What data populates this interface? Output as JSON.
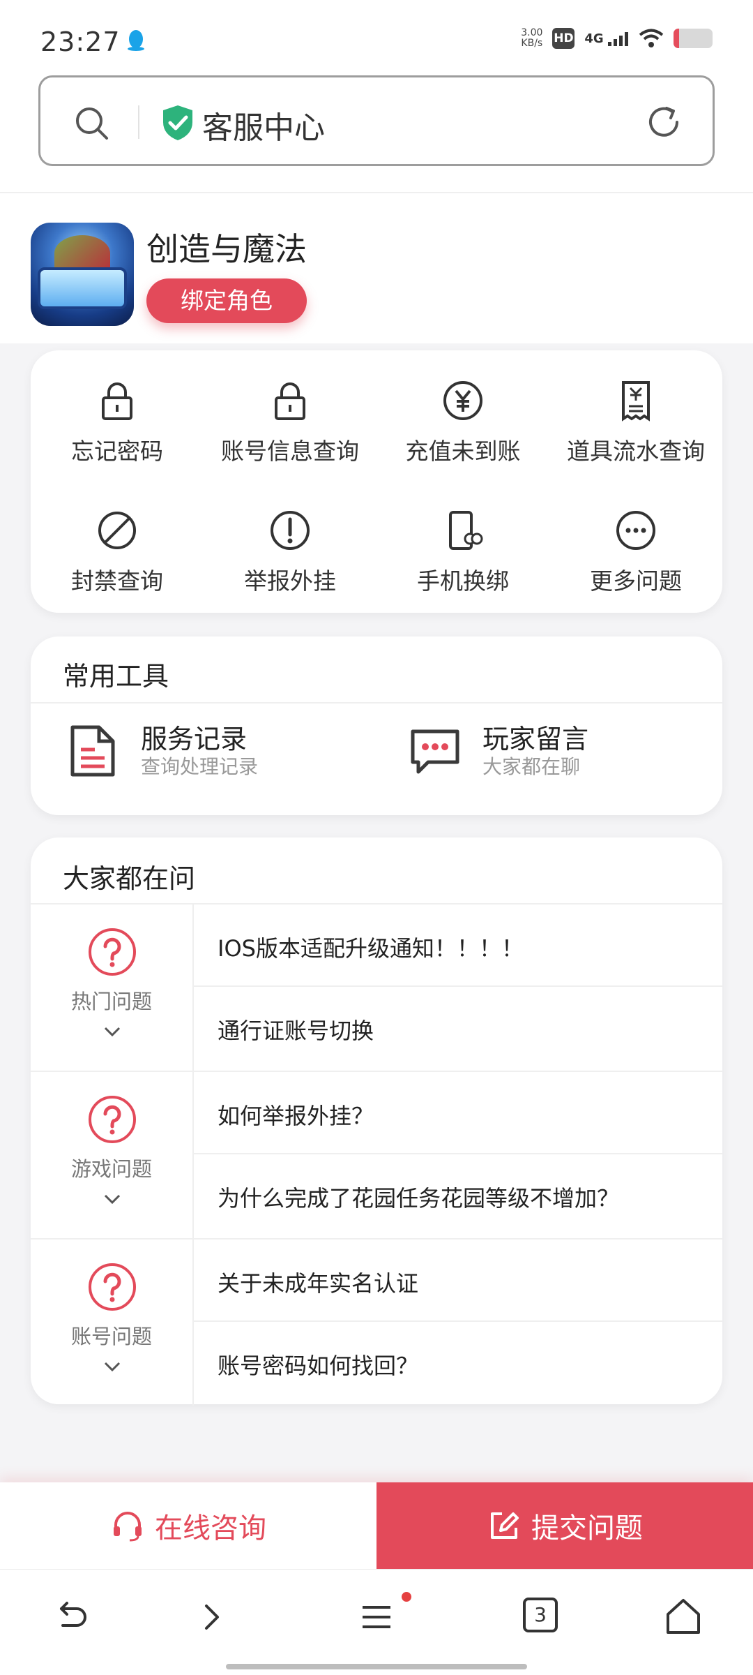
{
  "status": {
    "time": "23:27",
    "net_speed_value": "3.00",
    "net_speed_unit": "KB/s",
    "hd": "HD",
    "network": "4G"
  },
  "browser": {
    "title": "客服中心",
    "tab_count": "3"
  },
  "game": {
    "name": "创造与魔法",
    "bind_label": "绑定角色"
  },
  "quick_actions": [
    {
      "label": "忘记密码",
      "icon": "lock-icon"
    },
    {
      "label": "账号信息查询",
      "icon": "lock-icon"
    },
    {
      "label": "充值未到账",
      "icon": "yen-circle-icon"
    },
    {
      "label": "道具流水查询",
      "icon": "receipt-icon"
    },
    {
      "label": "封禁查询",
      "icon": "ban-icon"
    },
    {
      "label": "举报外挂",
      "icon": "exclamation-icon"
    },
    {
      "label": "手机换绑",
      "icon": "phone-link-icon"
    },
    {
      "label": "更多问题",
      "icon": "more-icon"
    }
  ],
  "tools": {
    "title": "常用工具",
    "items": [
      {
        "name": "服务记录",
        "sub": "查询处理记录",
        "icon": "document-icon"
      },
      {
        "name": "玩家留言",
        "sub": "大家都在聊",
        "icon": "chat-icon"
      }
    ]
  },
  "faq": {
    "title": "大家都在问",
    "groups": [
      {
        "category": "热门问题",
        "questions": [
          "IOS版本适配升级通知！！！！",
          "通行证账号切换"
        ]
      },
      {
        "category": "游戏问题",
        "questions": [
          "如何举报外挂？",
          "为什么完成了花园任务花园等级不增加？"
        ]
      },
      {
        "category": "账号问题",
        "questions": [
          "关于未成年实名认证",
          "账号密码如何找回？"
        ]
      }
    ]
  },
  "actions": {
    "online": "在线咨询",
    "submit": "提交问题"
  },
  "colors": {
    "accent": "#e34a5a",
    "shield": "#2db37c"
  }
}
